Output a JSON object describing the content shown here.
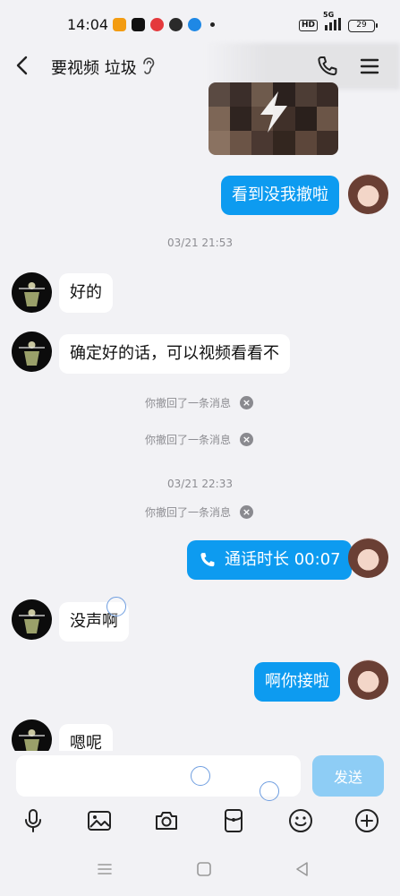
{
  "status_bar": {
    "time": "14:04",
    "network": "5G",
    "hd": "HD",
    "battery": "29"
  },
  "header": {
    "title": "要视频 垃圾",
    "icons": [
      "back-arrow-icon",
      "ear-icon",
      "phone-icon",
      "menu-icon"
    ]
  },
  "messages": {
    "out_1": "看到没我撤啦",
    "timestamp_1": "03/21 21:53",
    "in_1": "好的",
    "in_2": "确定好的话，可以视频看看不",
    "recall_1": "你撤回了一条消息",
    "recall_2": "你撤回了一条消息",
    "timestamp_2": "03/21 22:33",
    "recall_3": "你撤回了一条消息",
    "call_duration": "通话时长 00:07",
    "in_3": "没声啊",
    "out_2": "啊你接啦",
    "in_4": "嗯呢"
  },
  "composer": {
    "input_value": "",
    "send_label": "发送"
  },
  "toolbar_icons": [
    "microphone-icon",
    "image-icon",
    "camera-icon",
    "red-packet-icon",
    "emoji-icon",
    "plus-icon"
  ],
  "colors": {
    "accent": "#0d9bf0",
    "send_disabled": "#8ecdf5",
    "background": "#f2f2f5"
  }
}
